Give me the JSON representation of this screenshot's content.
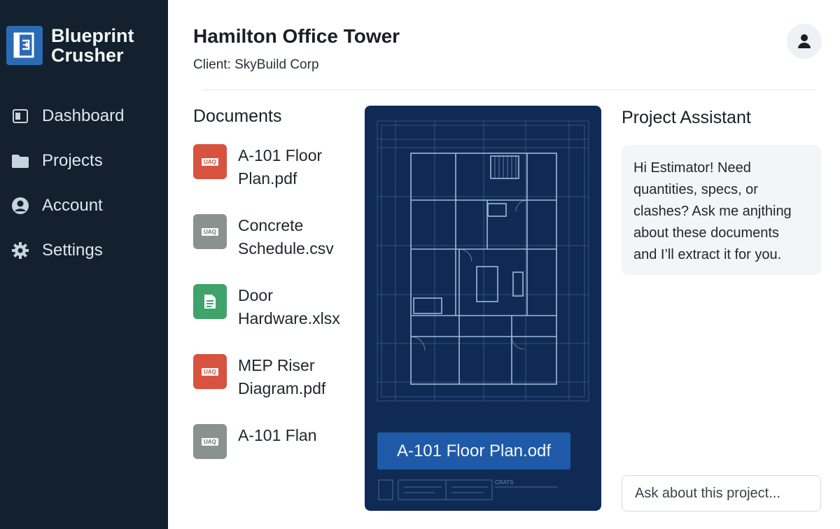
{
  "brand": {
    "line1": "Blueprint",
    "line2": "Crusher",
    "color": "#2b6bb4",
    "icon": "blueprint-logo-icon"
  },
  "sidebar": {
    "background": "#13202e",
    "items": [
      {
        "label": "Dashboard",
        "icon": "dashboard-icon"
      },
      {
        "label": "Projects",
        "icon": "folder-icon"
      },
      {
        "label": "Account",
        "icon": "user-circle-icon"
      },
      {
        "label": "Settings",
        "icon": "gear-icon"
      }
    ]
  },
  "header": {
    "title": "Hamilton Office Tower",
    "client": "Client: SkyBuild Corp",
    "avatar_icon": "user-icon"
  },
  "documents": {
    "title": "Documents",
    "items": [
      {
        "line1": "A-101 Floor",
        "line2": "Plan.pdf",
        "type": "pdf",
        "badge": "UAQ",
        "color": "#d8533f"
      },
      {
        "line1": "Concrete",
        "line2": "Schedule.csv",
        "type": "csv",
        "badge": "UAQ",
        "color": "#8a9290"
      },
      {
        "line1": "Door",
        "line2": "Hardware.xlsx",
        "type": "xlsx",
        "badge": "",
        "color": "#3fa36b"
      },
      {
        "line1": "MEP Riser",
        "line2": "Diagram.pdf",
        "type": "pdf",
        "badge": "UAQ",
        "color": "#d8533f"
      },
      {
        "line1": "A-101 Flan",
        "line2": "",
        "type": "csv",
        "badge": "UAQ",
        "color": "#8a9290"
      }
    ]
  },
  "viewer": {
    "label": "A-101 Floor Plan.odf",
    "background": "#0f2b55",
    "stamp_text": "CRATS"
  },
  "assistant": {
    "title": "Project Assistant",
    "message_lines": [
      "Hi Estimator! Need",
      "quantities, specs, or",
      "clashes? Ask me anjthing",
      "about these documents",
      "and I’ll extract it for you."
    ],
    "input_placeholder": "Ask about this project..."
  }
}
